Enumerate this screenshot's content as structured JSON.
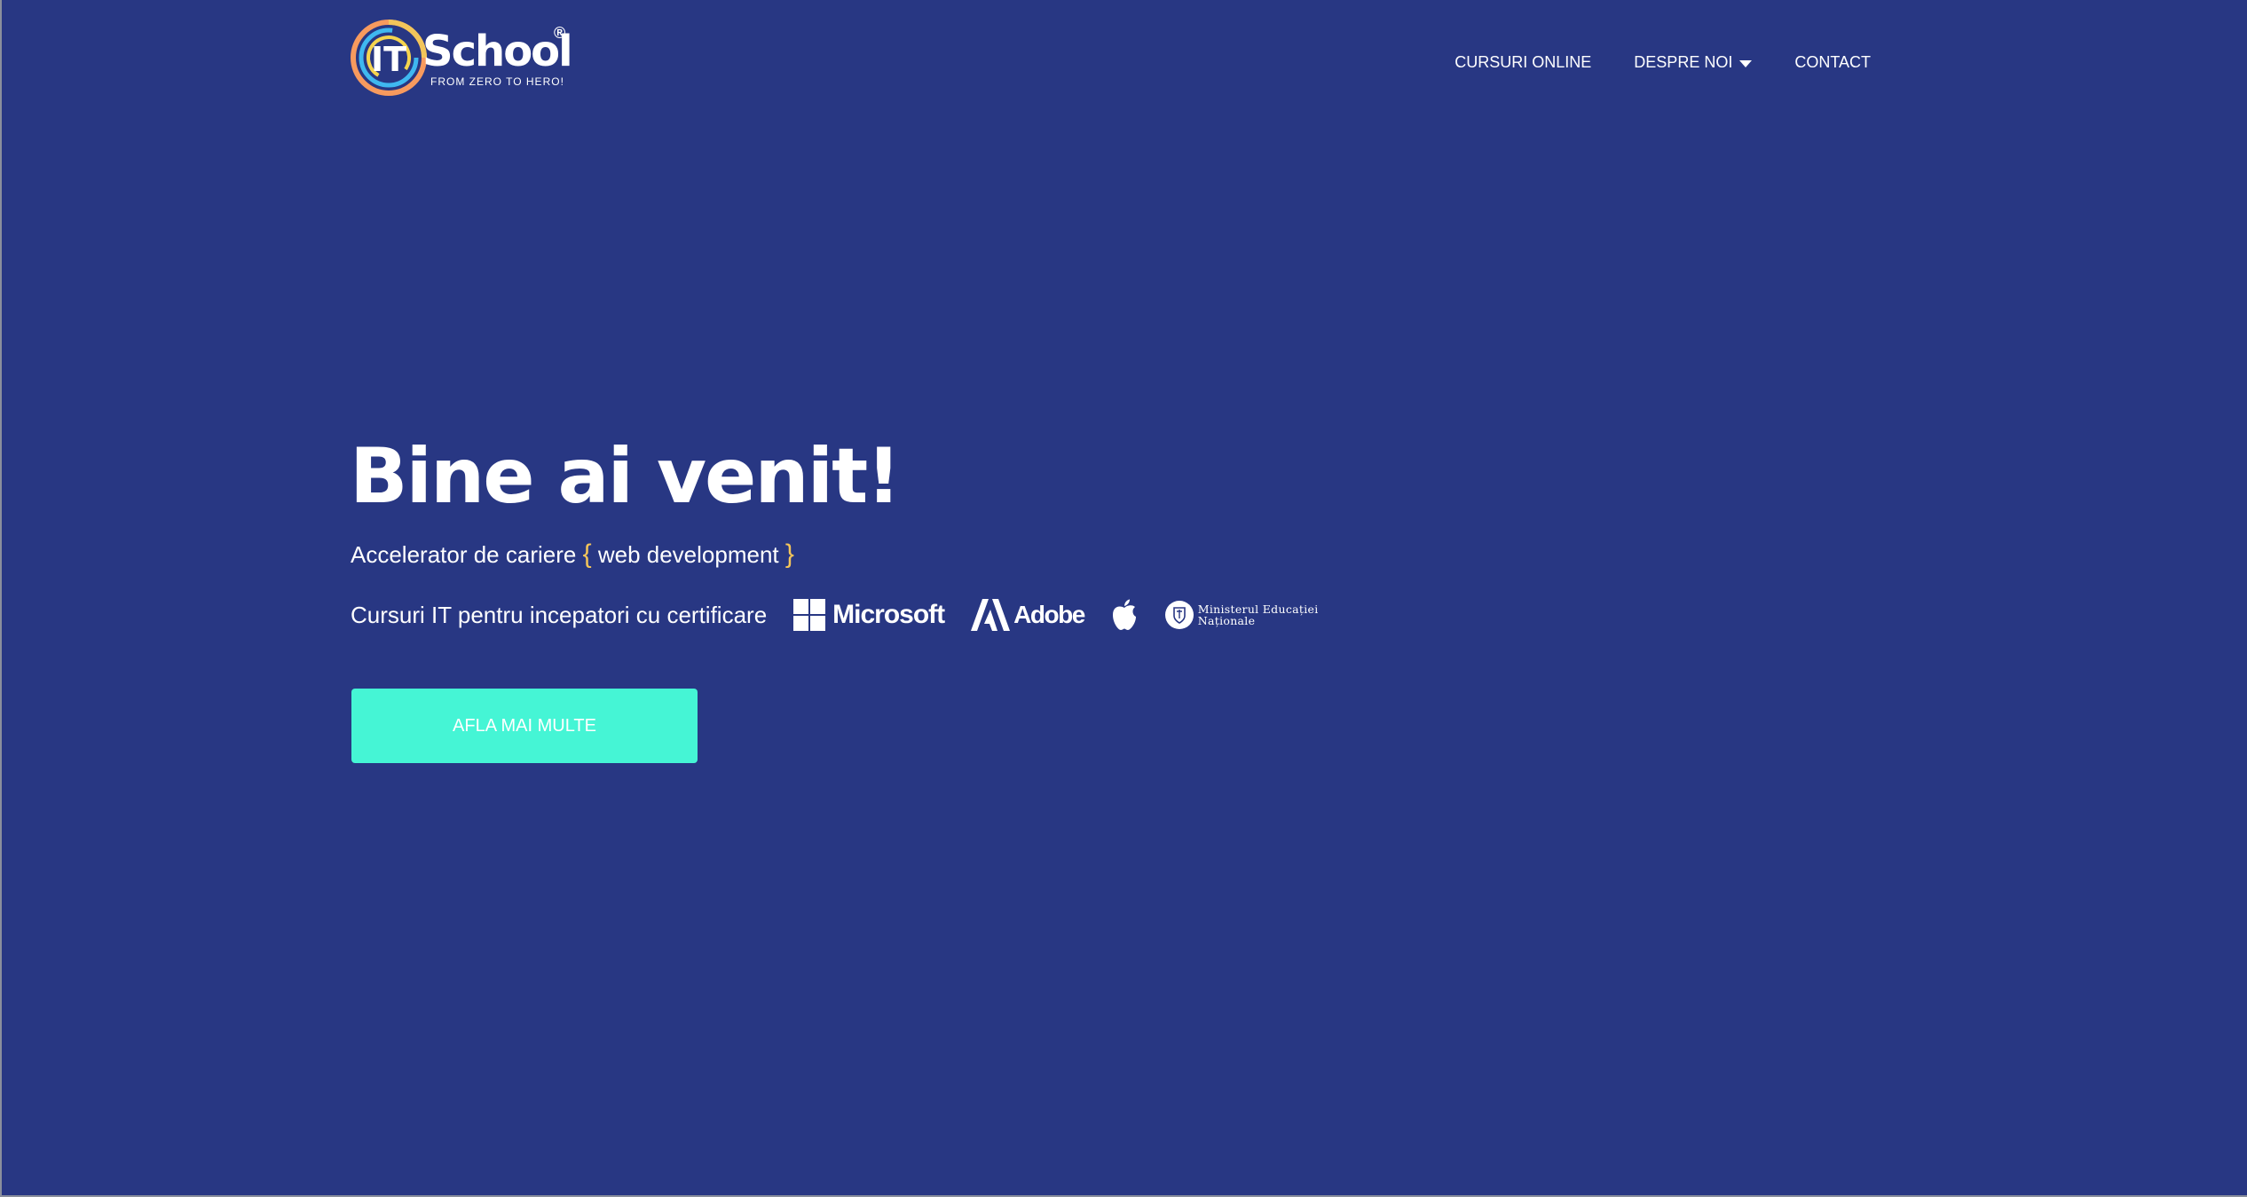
{
  "colors": {
    "background": "#283783",
    "accent_teal": "#45f5d5",
    "accent_yellow": "#f4c55a",
    "logo_ring_orange": "#f79a5e",
    "logo_ring_blue": "#3fb8f0",
    "logo_ring_yellow": "#f5d44e"
  },
  "header": {
    "logo": {
      "letters": "IT",
      "name": "School",
      "registered_mark": "®",
      "tagline": "FROM ZERO TO HERO!"
    },
    "nav": [
      {
        "label": "CURSURI ONLINE",
        "has_dropdown": false
      },
      {
        "label": "DESPRE NOI",
        "has_dropdown": true,
        "icon": "chevron-down-icon"
      },
      {
        "label": "CONTACT",
        "has_dropdown": false
      }
    ]
  },
  "hero": {
    "title": "Bine ai venit!",
    "subtitle_prefix": "Accelerator de cariere",
    "brace_open": "{",
    "subtitle_highlight": "web development",
    "brace_close": "}",
    "cert_text": "Cursuri IT pentru incepatori cu certificare",
    "partners": [
      {
        "name": "Microsoft",
        "icon": "microsoft-logo-icon"
      },
      {
        "name": "Adobe",
        "icon": "adobe-logo-icon"
      },
      {
        "name": "Apple",
        "icon": "apple-logo-icon"
      },
      {
        "name_line1": "Ministerul Educației",
        "name_line2": "Naționale",
        "icon": "ministry-crest-icon"
      }
    ],
    "cta_label": "AFLA MAI MULTE"
  }
}
